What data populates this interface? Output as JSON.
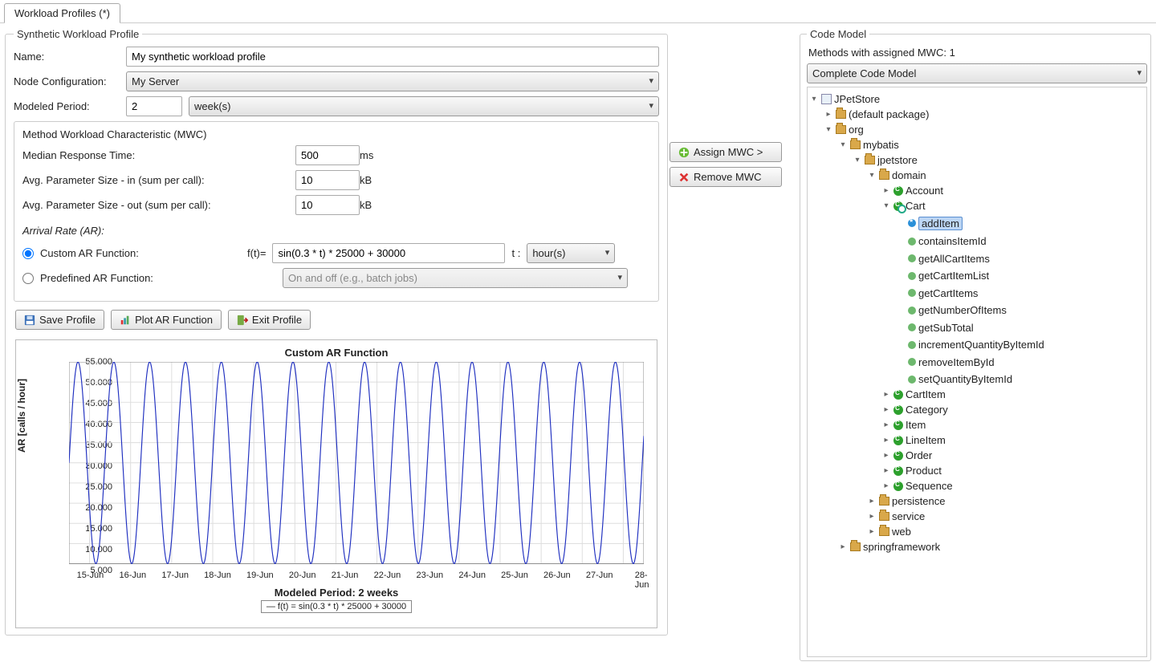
{
  "tab": {
    "label": "Workload Profiles (*)"
  },
  "profile": {
    "legend": "Synthetic Workload Profile",
    "name_label": "Name:",
    "name_value": "My synthetic workload profile",
    "nodecfg_label": "Node Configuration:",
    "nodecfg_value": "My Server",
    "period_label": "Modeled Period:",
    "period_value": "2",
    "period_unit": "week(s)"
  },
  "mwc": {
    "title": "Method Workload Characteristic (MWC)",
    "median_label": "Median Response Time:",
    "median_value": "500",
    "median_unit": "ms",
    "pin_label": "Avg. Parameter Size - in (sum per call):",
    "pin_value": "10",
    "pin_unit": "kB",
    "pout_label": "Avg. Parameter Size - out (sum per call):",
    "pout_value": "10",
    "pout_unit": "kB"
  },
  "ar": {
    "title": "Arrival Rate (AR):",
    "custom_label": "Custom AR Function:",
    "ft_label": "f(t)=",
    "ft_value": "sin(0.3 * t) * 25000 + 30000",
    "t_label": "t :",
    "t_unit": "hour(s)",
    "predef_label": "Predefined AR Function:",
    "predef_value": "On and off (e.g., batch jobs)"
  },
  "buttons": {
    "save": "Save Profile",
    "plot": "Plot AR Function",
    "exit": "Exit Profile",
    "assign": "Assign MWC >",
    "remove": "Remove MWC"
  },
  "code": {
    "legend": "Code Model",
    "summary": "Methods with assigned MWC: 1",
    "model_sel": "Complete Code Model",
    "root": "JPetStore",
    "defpkg": "(default package)",
    "org": "org",
    "mybatis": "mybatis",
    "jpetstore": "jpetstore",
    "domain": "domain",
    "account": "Account",
    "cart": "Cart",
    "cart_methods": [
      "addItem",
      "containsItemId",
      "getAllCartItems",
      "getCartItemList",
      "getCartItems",
      "getNumberOfItems",
      "getSubTotal",
      "incrementQuantityByItemId",
      "removeItemById",
      "setQuantityByItemId"
    ],
    "domain_classes": [
      "CartItem",
      "Category",
      "Item",
      "LineItem",
      "Order",
      "Product",
      "Sequence"
    ],
    "persistence": "persistence",
    "service": "service",
    "web": "web",
    "spring": "springframework"
  },
  "chart_data": {
    "type": "line",
    "title": "Custom AR Function",
    "ylabel": "AR  [calls / hour]",
    "xlabel": "Modeled Period: 2 weeks",
    "legend": "f(t) = sin(0.3 * t) * 25000 + 30000",
    "y_ticks": [
      "5.000",
      "10.000",
      "15.000",
      "20.000",
      "25.000",
      "30.000",
      "35.000",
      "40.000",
      "45.000",
      "50.000",
      "55.000"
    ],
    "ylim": [
      5000,
      55000
    ],
    "x_ticks": [
      "15-Jun",
      "16-Jun",
      "17-Jun",
      "18-Jun",
      "19-Jun",
      "20-Jun",
      "21-Jun",
      "22-Jun",
      "23-Jun",
      "24-Jun",
      "25-Jun",
      "26-Jun",
      "27-Jun",
      "28-Jun"
    ],
    "function": "30000 + 25000*sin(0.3*t)",
    "t_range_hours": [
      0,
      336
    ],
    "amplitude": 25000,
    "offset": 30000,
    "angular_freq_per_hour": 0.3
  }
}
